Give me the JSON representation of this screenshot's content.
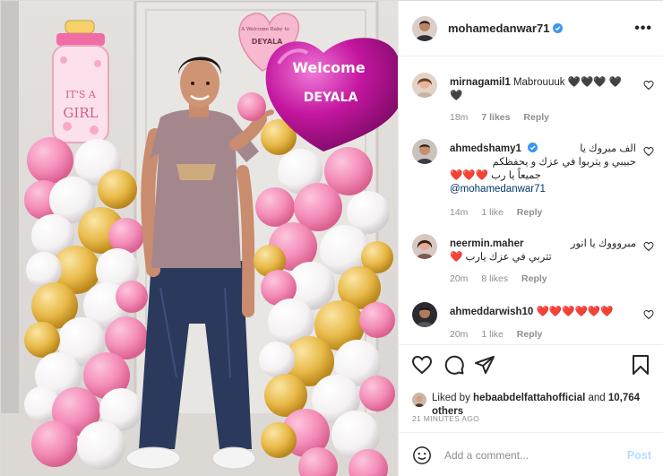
{
  "post": {
    "username": "mohamedanwar71",
    "more_label": "•••"
  },
  "photo": {
    "balloon_heart_line1": "Welcome",
    "balloon_heart_line2": "DEYALA",
    "small_heart_line1": "A Welcome Baby to",
    "small_heart_line2": "DEYALA",
    "bottle_line1": "IT'S A",
    "bottle_line2": "GIRL"
  },
  "comments": [
    {
      "username": "mirnagamil1",
      "text": "Mabrouuuk 🖤🖤🖤 🖤🖤",
      "time": "18m",
      "likes": "7 likes",
      "reply": "Reply"
    },
    {
      "username": "ahmedshamy1",
      "text_line1": "الف مبروك يا",
      "text_line2": "حبيبي و يتربوا في عزك و يحفظكم",
      "text_line3": "جميعاً يا رب ❤️❤️❤️",
      "mention": "@mohamedanwar71",
      "time": "14m",
      "likes": "1 like",
      "reply": "Reply"
    },
    {
      "username": "neermin.maher",
      "text_line1": "مبروووك يا انور",
      "text_line2": "تتربي في عزك يارب ❤️",
      "time": "20m",
      "likes": "8 likes",
      "reply": "Reply"
    },
    {
      "username": "ahmeddarwish10",
      "text": "❤️❤️❤️❤️❤️❤️",
      "time": "20m",
      "likes": "1 like",
      "reply": "Reply"
    }
  ],
  "likes": {
    "prefix": "Liked by",
    "liker": "hebaabdelfattahofficial",
    "and": "and",
    "others": "10,764 others"
  },
  "time_ago": "21 MINUTES AGO",
  "add_comment": {
    "placeholder": "Add a comment...",
    "post_label": "Post"
  },
  "colors": {
    "accent_blue": "#0095f6",
    "verified_blue": "#3897f0",
    "heart_red": "#ed4956",
    "balloon_magenta": "#c0139b",
    "balloon_pink": "#f47eb0",
    "balloon_gold": "#e3b23c"
  },
  "icons": [
    "more-icon",
    "heart-icon",
    "comment-icon",
    "share-icon",
    "bookmark-icon",
    "emoji-icon",
    "verified-icon"
  ]
}
